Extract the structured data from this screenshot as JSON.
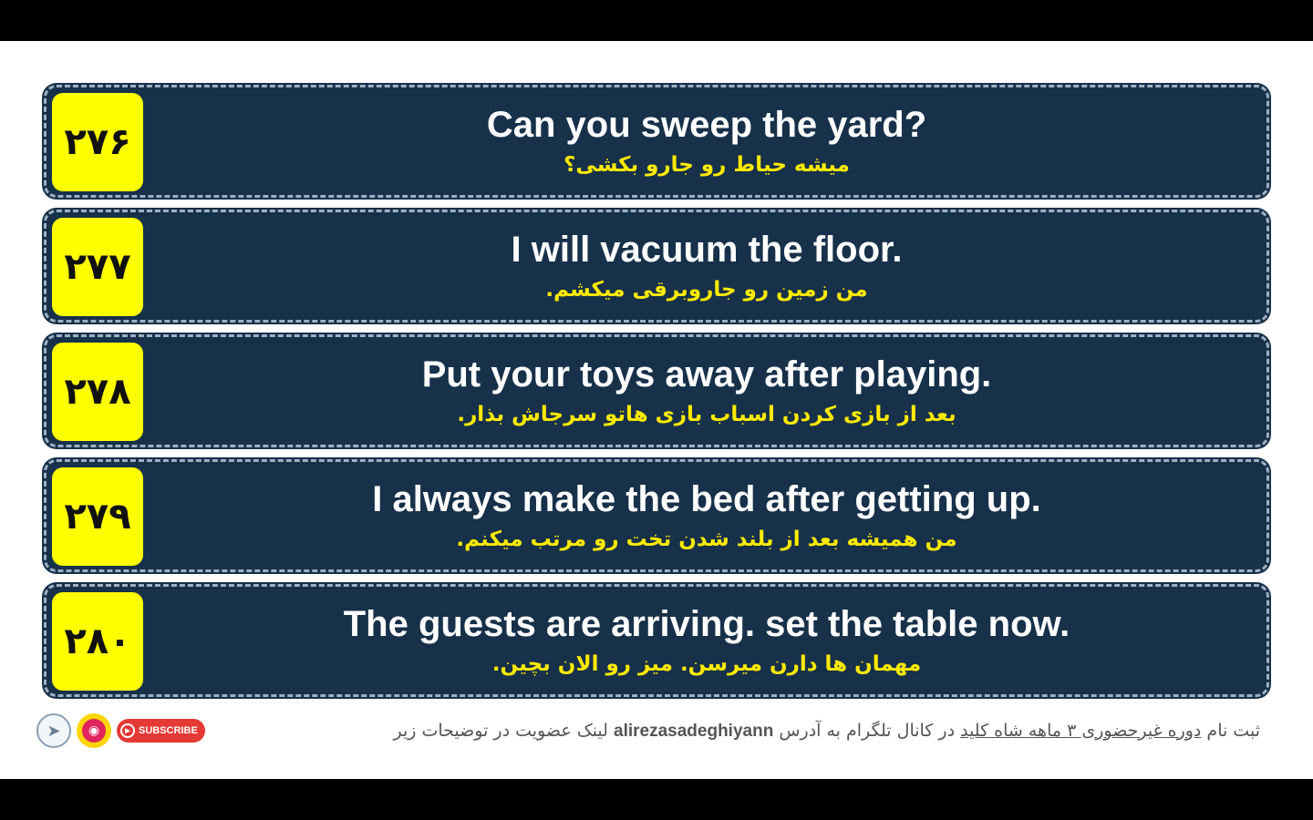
{
  "cards": [
    {
      "number": "۲۷۶",
      "english": "Can you sweep the yard?",
      "persian": "میشه حیاط رو جارو بکشی؟"
    },
    {
      "number": "۲۷۷",
      "english": "I will vacuum the floor.",
      "persian": "من زمین رو جاروبرقی میکشم."
    },
    {
      "number": "۲۷۸",
      "english": "Put your toys away after playing.",
      "persian": "بعد از بازی کردن اسباب بازی هاتو سرجاش بذار."
    },
    {
      "number": "۲۷۹",
      "english": "I always make the bed after getting up.",
      "persian": "من همیشه بعد از بلند شدن تخت رو مرتب میکنم."
    },
    {
      "number": "۲۸۰",
      "english": "The guests are arriving. set the table now.",
      "persian": "مهمان ها دارن میرسن. میز رو الان بچین."
    }
  ],
  "footer": {
    "promo_part1": "ثبت نام ",
    "promo_link": "دوره غیرحضوری ۳ ماهه شاه کلید",
    "promo_part2": " در کانال تلگرام به آدرس ",
    "handle": "alirezasadeghiyann",
    "promo_part3": " لینک عضویت در توضیحات زیر",
    "subscribe_label": "SUBSCRIBE",
    "icons": [
      "telegram-icon",
      "instagram-icon",
      "youtube-play-icon"
    ]
  },
  "colors": {
    "card_bg": "#17314a",
    "number_bg": "#ffff00",
    "english_text": "#ffffff",
    "persian_text": "#ffea00",
    "subscribe_bg": "#e53935"
  }
}
